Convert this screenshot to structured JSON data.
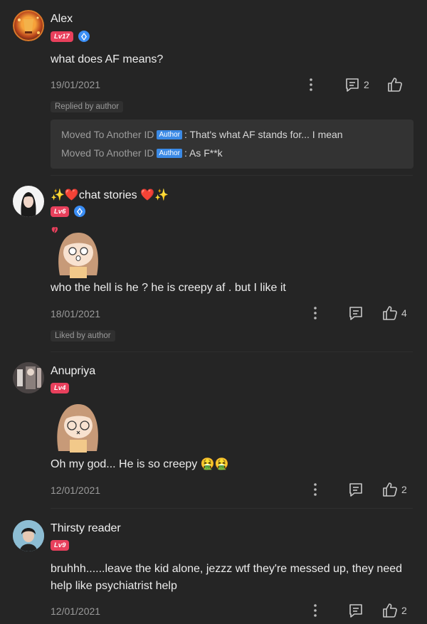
{
  "comments": [
    {
      "username": "Alex",
      "level": "Lv17",
      "verified": true,
      "text": "what does AF means?",
      "date": "19/01/2021",
      "comment_count": "2",
      "like_count": "",
      "tag": "Replied by author",
      "replies": [
        {
          "name": "Moved To Another ID",
          "badge": "Author",
          "text": ": That's what AF stands for... I mean"
        },
        {
          "name": "Moved To Another ID",
          "badge": "Author",
          "text": ": As F**k"
        }
      ]
    },
    {
      "username": "✨❤️chat stories ❤️✨",
      "level": "Lv6",
      "verified": true,
      "text": "who the hell is he ? he is creepy af . but I like it",
      "date": "18/01/2021",
      "comment_count": "",
      "like_count": "4",
      "tag": "Liked by author"
    },
    {
      "username": "Anupriya",
      "level": "Lv4",
      "verified": false,
      "text": "Oh my god... He is so creepy 🤮🤮",
      "date": "12/01/2021",
      "comment_count": "",
      "like_count": "2"
    },
    {
      "username": "Thirsty reader",
      "level": "Lv9",
      "verified": false,
      "text": "bruhhh......leave the kid alone, jezzz wtf they're messed up, they need help like psychiatrist help",
      "date": "12/01/2021",
      "comment_count": "",
      "like_count": "2"
    }
  ],
  "icons": {
    "more": "more-vertical-icon",
    "comment": "comment-icon",
    "like": "thumbs-up-icon",
    "verified": "verified-icon"
  },
  "colors": {
    "background": "#252525",
    "level_badge": "#e8405c",
    "author_badge": "#3b8ae6",
    "verified": "#3a8ef6"
  }
}
